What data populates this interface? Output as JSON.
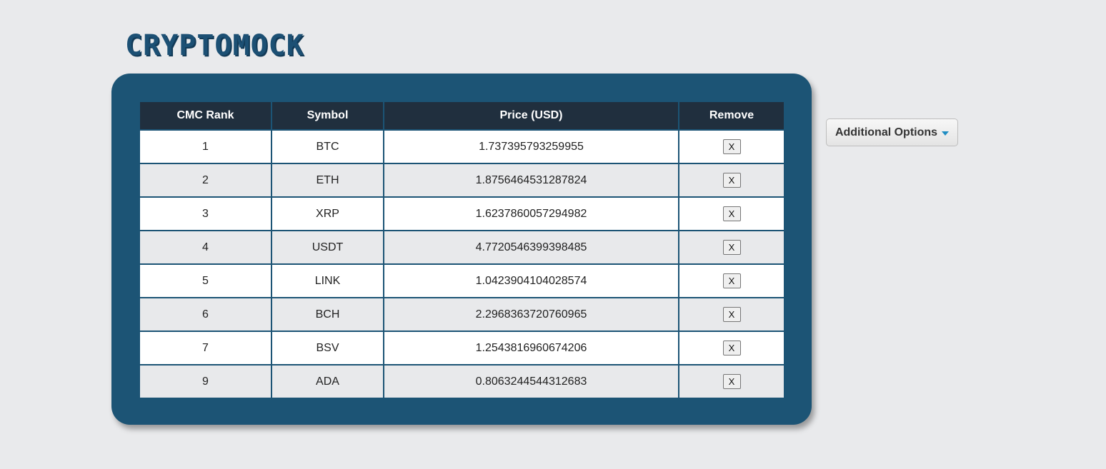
{
  "app": {
    "logo": "CRYPTOMOCK"
  },
  "table": {
    "columns": [
      "CMC Rank",
      "Symbol",
      "Price (USD)",
      "Remove"
    ],
    "rows": [
      {
        "rank": "1",
        "symbol": "BTC",
        "price": "1.737395793259955",
        "remove": "X"
      },
      {
        "rank": "2",
        "symbol": "ETH",
        "price": "1.8756464531287824",
        "remove": "X"
      },
      {
        "rank": "3",
        "symbol": "XRP",
        "price": "1.6237860057294982",
        "remove": "X"
      },
      {
        "rank": "4",
        "symbol": "USDT",
        "price": "4.7720546399398485",
        "remove": "X"
      },
      {
        "rank": "5",
        "symbol": "LINK",
        "price": "1.0423904104028574",
        "remove": "X"
      },
      {
        "rank": "6",
        "symbol": "BCH",
        "price": "2.2968363720760965",
        "remove": "X"
      },
      {
        "rank": "7",
        "symbol": "BSV",
        "price": "1.2543816960674206",
        "remove": "X"
      },
      {
        "rank": "9",
        "symbol": "ADA",
        "price": "0.8063244544312683",
        "remove": "X"
      }
    ]
  },
  "options": {
    "label": "Additional Options",
    "icon": "caret-down-icon"
  },
  "colors": {
    "background": "#e9eaec",
    "panel": "#1c5475",
    "header": "#202f3e",
    "logo": "#1c5074",
    "caret": "#1f8dc3"
  }
}
